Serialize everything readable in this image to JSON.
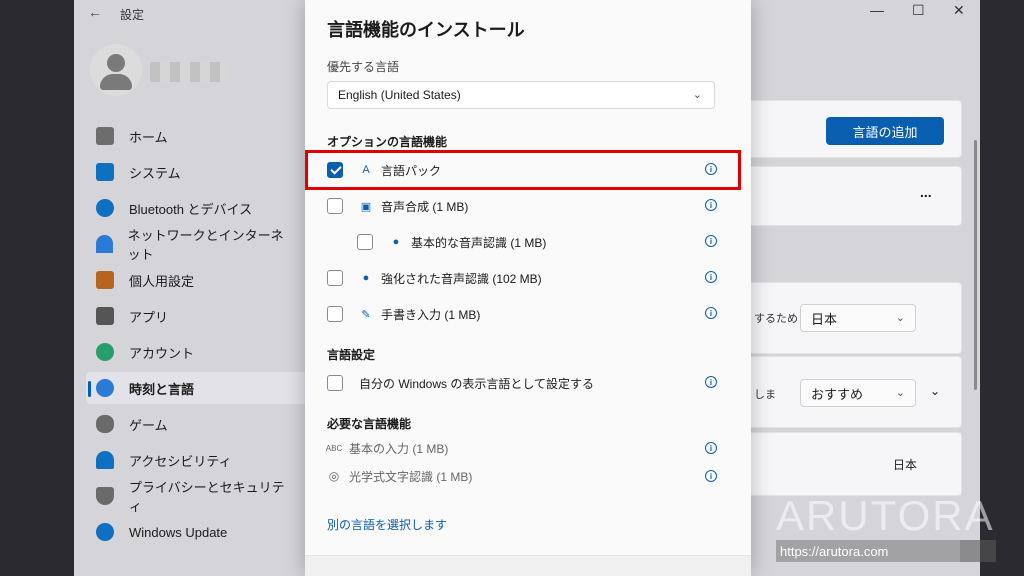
{
  "window": {
    "title": "設定",
    "add_language_button": "言語の追加",
    "dropdown_region": "日本",
    "dropdown_recommended": "おすすめ",
    "static_region": "日本",
    "partial_text_1": "するため",
    "partial_text_2": "しま",
    "more": "..."
  },
  "sidebar": {
    "items": [
      {
        "label": "ホーム",
        "icon": "home-icon",
        "color": "#5a5a5a"
      },
      {
        "label": "システム",
        "icon": "system-icon",
        "color": "#0f6fc0"
      },
      {
        "label": "Bluetooth とデバイス",
        "icon": "bluetooth-icon",
        "color": "#0f6fc0"
      },
      {
        "label": "ネットワークとインターネット",
        "icon": "network-icon",
        "color": "#2b7bd6"
      },
      {
        "label": "個人用設定",
        "icon": "brush-icon",
        "color": "#b5651d"
      },
      {
        "label": "アプリ",
        "icon": "apps-icon",
        "color": "#555"
      },
      {
        "label": "アカウント",
        "icon": "account-icon",
        "color": "#2a9d6f"
      },
      {
        "label": "時刻と言語",
        "icon": "time-language-icon",
        "color": "#2b7bd6"
      },
      {
        "label": "ゲーム",
        "icon": "gaming-icon",
        "color": "#6a6a6a"
      },
      {
        "label": "アクセシビリティ",
        "icon": "accessibility-icon",
        "color": "#0f6fc0"
      },
      {
        "label": "プライバシーとセキュリティ",
        "icon": "shield-icon",
        "color": "#6a6a6a"
      },
      {
        "label": "Windows Update",
        "icon": "update-icon",
        "color": "#0f6fc0"
      }
    ]
  },
  "dialog": {
    "title": "言語機能のインストール",
    "preferred_label": "優先する言語",
    "preferred_value": "English (United States)",
    "optional_section": "オプションの言語機能",
    "options": [
      {
        "label": "言語パック",
        "checked": true,
        "icon": "language-pack-icon"
      },
      {
        "label": "音声合成 (1 MB)",
        "checked": false,
        "icon": "text-to-speech-icon"
      },
      {
        "label": "基本的な音声認識 (1 MB)",
        "checked": false,
        "icon": "microphone-icon"
      },
      {
        "label": "強化された音声認識 (102 MB)",
        "checked": false,
        "icon": "microphone-icon"
      },
      {
        "label": "手書き入力 (1 MB)",
        "checked": false,
        "icon": "handwriting-icon"
      }
    ],
    "settings_section": "言語設定",
    "display_option": "自分の Windows の表示言語として設定する",
    "required_section": "必要な言語機能",
    "required": [
      {
        "label": "基本の入力 (1 MB)",
        "icon": "abc-input-icon"
      },
      {
        "label": "光学式文字認識 (1 MB)",
        "icon": "ocr-camera-icon"
      }
    ],
    "choose_other_link": "別の言語を選択します"
  },
  "watermark": {
    "text": "ARUTORA",
    "url": "https://arutora.com"
  }
}
